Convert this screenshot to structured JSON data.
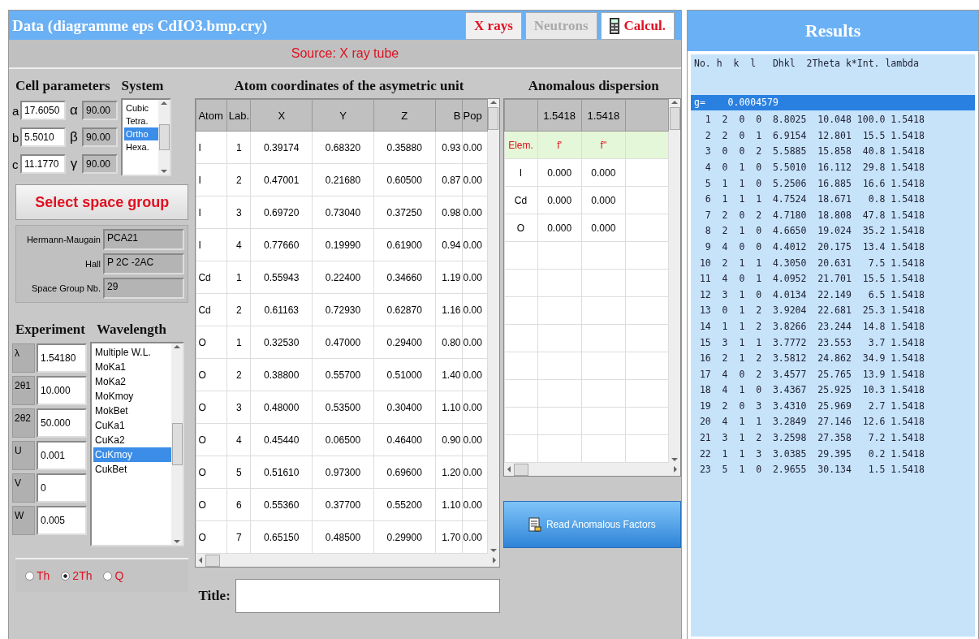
{
  "data_window": {
    "title": "Data (diagramme eps CdIO3.bmp.cry)",
    "tabs": [
      {
        "label": "X rays",
        "selected": true
      },
      {
        "label": "Neutrons",
        "selected": false
      }
    ],
    "calc_button": "Calcul.",
    "source": "Source: X ray tube"
  },
  "cell_parameters": {
    "heading": "Cell parameters",
    "rows": [
      {
        "axis": "a",
        "value": "17.6050",
        "angle_symbol": "α",
        "angle": "90.00"
      },
      {
        "axis": "b",
        "value": "5.5010",
        "angle_symbol": "β",
        "angle": "90.00"
      },
      {
        "axis": "c",
        "value": "11.1770",
        "angle_symbol": "γ",
        "angle": "90.00"
      }
    ]
  },
  "system": {
    "heading": "System",
    "items": [
      {
        "label": "Cubic",
        "selected": false
      },
      {
        "label": "Tetra.",
        "selected": false
      },
      {
        "label": "Ortho",
        "selected": true
      },
      {
        "label": "Hexa.",
        "selected": false
      }
    ]
  },
  "space_group_button": "Select space group",
  "space_group": [
    {
      "label": "Hermann-Maugain",
      "value": "PCA21"
    },
    {
      "label": "Hall",
      "value": "P 2C -2AC"
    },
    {
      "label": "Space Group Nb.",
      "value": "29"
    }
  ],
  "experiment": {
    "heading": "Experiment",
    "rows": [
      {
        "label": "λ",
        "value": "1.54180"
      },
      {
        "label": "2θ1",
        "value": "10.000"
      },
      {
        "label": "2θ2",
        "value": "50.000"
      },
      {
        "label": "U",
        "value": "0.001"
      },
      {
        "label": "V",
        "value": "0"
      },
      {
        "label": "W",
        "value": "0.005"
      }
    ]
  },
  "wavelength": {
    "heading": "Wavelength",
    "items": [
      {
        "label": "Multiple W.L.",
        "selected": false
      },
      {
        "label": "MoKa1",
        "selected": false
      },
      {
        "label": "MoKa2",
        "selected": false
      },
      {
        "label": "MoKmoy",
        "selected": false
      },
      {
        "label": "MokBet",
        "selected": false
      },
      {
        "label": "CuKa1",
        "selected": false
      },
      {
        "label": "CuKa2",
        "selected": false
      },
      {
        "label": "CuKmoy",
        "selected": true
      },
      {
        "label": "CukBet",
        "selected": false
      }
    ]
  },
  "scan_mode": [
    {
      "label": "Th",
      "selected": false
    },
    {
      "label": "2Th",
      "selected": true
    },
    {
      "label": "Q",
      "selected": false
    }
  ],
  "atoms": {
    "heading": "Atom coordinates of the asymetric unit",
    "columns": [
      "Atom",
      "Lab.",
      "X",
      "Y",
      "Z",
      "B",
      "Pop"
    ],
    "rows": [
      [
        "I",
        "1",
        "0.39174",
        "0.68320",
        "0.35880",
        "0.93",
        "0.00"
      ],
      [
        "I",
        "2",
        "0.47001",
        "0.21680",
        "0.60500",
        "0.87",
        "0.00"
      ],
      [
        "I",
        "3",
        "0.69720",
        "0.73040",
        "0.37250",
        "0.98",
        "0.00"
      ],
      [
        "I",
        "4",
        "0.77660",
        "0.19990",
        "0.61900",
        "0.94",
        "0.00"
      ],
      [
        "Cd",
        "1",
        "0.55943",
        "0.22400",
        "0.34660",
        "1.19",
        "0.00"
      ],
      [
        "Cd",
        "2",
        "0.61163",
        "0.72930",
        "0.62870",
        "1.16",
        "0.00"
      ],
      [
        "O",
        "1",
        "0.32530",
        "0.47000",
        "0.29400",
        "0.80",
        "0.00"
      ],
      [
        "O",
        "2",
        "0.38800",
        "0.55700",
        "0.51000",
        "1.40",
        "0.00"
      ],
      [
        "O",
        "3",
        "0.48000",
        "0.53500",
        "0.30400",
        "1.10",
        "0.00"
      ],
      [
        "O",
        "4",
        "0.45440",
        "0.06500",
        "0.46400",
        "0.90",
        "0.00"
      ],
      [
        "O",
        "5",
        "0.51610",
        "0.97300",
        "0.69600",
        "1.20",
        "0.00"
      ],
      [
        "O",
        "6",
        "0.55360",
        "0.37700",
        "0.55200",
        "1.10",
        "0.00"
      ],
      [
        "O",
        "7",
        "0.65150",
        "0.48500",
        "0.29900",
        "1.70",
        "0.00"
      ]
    ]
  },
  "title_field": {
    "label": "Title:"
  },
  "anomalous": {
    "heading": "Anomalous dispersion",
    "columns": [
      "",
      "1.5418",
      "1.5418",
      ""
    ],
    "rows": [
      [
        "Elem.",
        "f'",
        "f\"",
        ""
      ],
      [
        "I",
        "0.000",
        "0.000",
        ""
      ],
      [
        "Cd",
        "0.000",
        "0.000",
        ""
      ],
      [
        "O",
        "0.000",
        "0.000",
        ""
      ]
    ]
  },
  "read_button": "Read Anomalous Factors",
  "results": {
    "title": "Results",
    "header": "No. h  k  l   Dhkl  2Theta k*Int. lambda",
    "lines": [
      {
        "text": "g=    0.0004579",
        "selected": true
      },
      {
        "text": "  1  2  0  0  8.8025  10.048 100.0 1.5418",
        "selected": false
      },
      {
        "text": "  2  2  0  1  6.9154  12.801  15.5 1.5418",
        "selected": false
      },
      {
        "text": "  3  0  0  2  5.5885  15.858  40.8 1.5418",
        "selected": false
      },
      {
        "text": "  4  0  1  0  5.5010  16.112  29.8 1.5418",
        "selected": false
      },
      {
        "text": "  5  1  1  0  5.2506  16.885  16.6 1.5418",
        "selected": false
      },
      {
        "text": "  6  1  1  1  4.7524  18.671   0.8 1.5418",
        "selected": false
      },
      {
        "text": "  7  2  0  2  4.7180  18.808  47.8 1.5418",
        "selected": false
      },
      {
        "text": "  8  2  1  0  4.6650  19.024  35.2 1.5418",
        "selected": false
      },
      {
        "text": "  9  4  0  0  4.4012  20.175  13.4 1.5418",
        "selected": false
      },
      {
        "text": " 10  2  1  1  4.3050  20.631   7.5 1.5418",
        "selected": false
      },
      {
        "text": " 11  4  0  1  4.0952  21.701  15.5 1.5418",
        "selected": false
      },
      {
        "text": " 12  3  1  0  4.0134  22.149   6.5 1.5418",
        "selected": false
      },
      {
        "text": " 13  0  1  2  3.9204  22.681  25.3 1.5418",
        "selected": false
      },
      {
        "text": " 14  1  1  2  3.8266  23.244  14.8 1.5418",
        "selected": false
      },
      {
        "text": " 15  3  1  1  3.7772  23.553   3.7 1.5418",
        "selected": false
      },
      {
        "text": " 16  2  1  2  3.5812  24.862  34.9 1.5418",
        "selected": false
      },
      {
        "text": " 17  4  0  2  3.4577  25.765  13.9 1.5418",
        "selected": false
      },
      {
        "text": " 18  4  1  0  3.4367  25.925  10.3 1.5418",
        "selected": false
      },
      {
        "text": " 19  2  0  3  3.4310  25.969   2.7 1.5418",
        "selected": false
      },
      {
        "text": " 20  4  1  1  3.2849  27.146  12.6 1.5418",
        "selected": false
      },
      {
        "text": " 21  3  1  2  3.2598  27.358   7.2 1.5418",
        "selected": false
      },
      {
        "text": " 22  1  1  3  3.0385  29.395   0.2 1.5418",
        "selected": false
      },
      {
        "text": " 23  5  1  0  2.9655  30.134   1.5 1.5418",
        "selected": false
      }
    ]
  }
}
